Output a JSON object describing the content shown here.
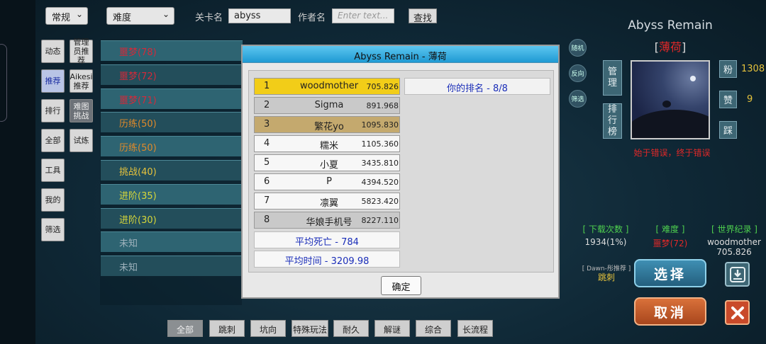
{
  "topbar": {
    "sort_select": "常规",
    "difficulty_select": "难度",
    "level_name_label": "关卡名",
    "level_name_value": "abyss",
    "author_label": "作者名",
    "author_placeholder": "Enter text...",
    "search_button": "查找"
  },
  "nav": {
    "items": [
      "动态",
      "推荐",
      "排行",
      "全部",
      "工具",
      "我的",
      "筛选"
    ],
    "sub_items": [
      "管理员推荐",
      "Aikesi推荐",
      "难图挑战",
      "试炼"
    ],
    "active": "推荐"
  },
  "levels": [
    {
      "label": "噩梦",
      "count": "(78)",
      "color": "#d22a3a"
    },
    {
      "label": "噩梦",
      "count": "(72)",
      "color": "#d22a3a"
    },
    {
      "label": "噩梦",
      "count": "(71)",
      "color": "#d22a3a"
    },
    {
      "label": "历练",
      "count": "(50)",
      "color": "#e08a2a"
    },
    {
      "label": "历练",
      "count": "(50)",
      "color": "#e08a2a"
    },
    {
      "label": "挑战",
      "count": "(40)",
      "color": "#e6c33c"
    },
    {
      "label": "进阶",
      "count": "(35)",
      "color": "#d6d63a"
    },
    {
      "label": "进阶",
      "count": "(30)",
      "color": "#d6d63a"
    },
    {
      "label": "未知",
      "count": "",
      "color": "#9fb3bd"
    },
    {
      "label": "未知",
      "count": "",
      "color": "#9fb3bd"
    }
  ],
  "side_round_buttons": [
    "随机",
    "反向",
    "筛选"
  ],
  "modal": {
    "title": "Abyss Remain - 薄荷",
    "rankings": [
      {
        "rank": "1",
        "name": "woodmother",
        "score": "705.826",
        "style": "gold"
      },
      {
        "rank": "2",
        "name": "Sigma",
        "score": "891.968",
        "style": "silver"
      },
      {
        "rank": "3",
        "name": "繁花yo",
        "score": "1095.830",
        "style": "bronze"
      },
      {
        "rank": "4",
        "name": "糯米",
        "score": "1105.360",
        "style": "plain"
      },
      {
        "rank": "5",
        "name": "小夏",
        "score": "3435.810",
        "style": "plain"
      },
      {
        "rank": "6",
        "name": "P",
        "score": "4394.520",
        "style": "plain"
      },
      {
        "rank": "7",
        "name": "凛翼",
        "score": "5823.420",
        "style": "plain"
      },
      {
        "rank": "8",
        "name": "华娘手机号",
        "score": "8227.110",
        "style": "silver"
      }
    ],
    "avg_deaths": "平均死亡 - 784",
    "avg_time": "平均时间 - 3209.98",
    "my_rank": "你的排名 - 8/8",
    "ok_button": "确定"
  },
  "detail": {
    "title": "Abyss Remain",
    "author_open": "[",
    "author": "薄荷",
    "author_close": "]",
    "manage_button": "管理",
    "ranking_button": "排行榜",
    "fans_label": "粉",
    "fans_count": "1308",
    "likes_label": "赞",
    "likes_count": "9",
    "dislike_label": "踩",
    "motto": "始于错误，终于错误",
    "downloads_header": "[ 下载次数 ]",
    "downloads_value": "1934(1%)",
    "difficulty_header": "[ 难度 ]",
    "difficulty_value": "噩梦(72)",
    "record_header": "[ 世界纪录 ]",
    "record_holder": "woodmother",
    "record_time": "705.826",
    "dawn_label": "[ Dawn-彤推荐 ]",
    "dawn_value": "跳刺",
    "select_button": "选择",
    "cancel_button": "取消",
    "accent_red": "#e02828",
    "accent_gold": "#e6c33c",
    "accent_green": "#4ecf4e"
  },
  "bottom_tabs": [
    "全部",
    "跳刺",
    "坑向",
    "特殊玩法",
    "耐久",
    "解谜",
    "综合",
    "长流程"
  ],
  "icons": {
    "download": "download-icon",
    "close": "close-x-icon"
  }
}
